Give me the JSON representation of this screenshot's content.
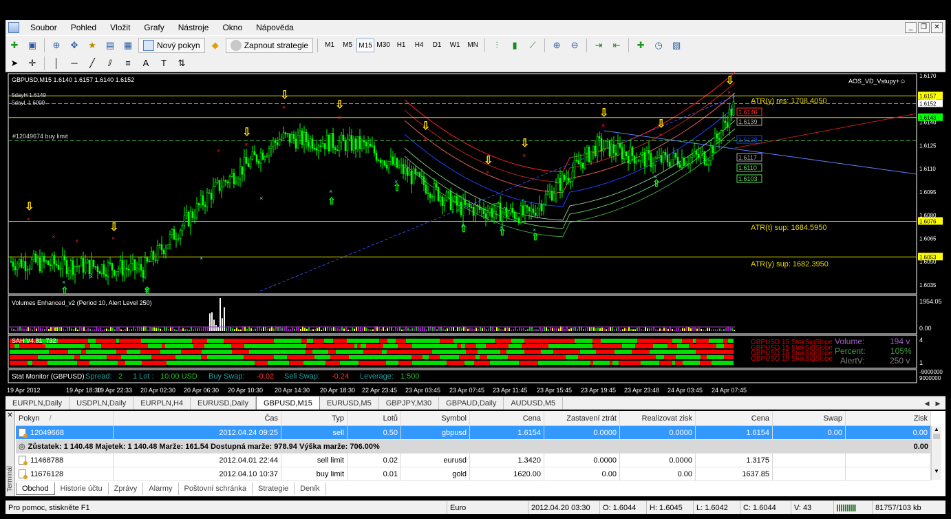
{
  "menu": [
    "Soubor",
    "Pohled",
    "Vložit",
    "Grafy",
    "Nástroje",
    "Okno",
    "Nápověda"
  ],
  "toolbar": {
    "new_order": "Nový pokyn",
    "strategy": "Zapnout strategie",
    "timeframes": [
      "M1",
      "M5",
      "M15",
      "M30",
      "H1",
      "H4",
      "D1",
      "W1",
      "MN"
    ],
    "active_timeframe": "M15"
  },
  "chart": {
    "symbol_line": "GBPUSD,M15  1.6140 1.6157 1.6140 1.6152",
    "indicator_name": "AOS_VD_Vstupy+☺",
    "overlay_top1": "5dayH 1.6149",
    "overlay_top2": "5dayL 1.6009",
    "buy_limit_label": "#12049674 buy limit",
    "atr_y_res": "ATR(y) res: 1708.4050",
    "atr_t_sup": "ATR(t) sup: 1684.5950",
    "atr_y_sup": "ATR(y) sup: 1682.3950",
    "price_labels": [
      "1.6170",
      "1.6155",
      "1.6140",
      "1.6125",
      "1.6110",
      "1.6095",
      "1.6080",
      "1.6065",
      "1.6050",
      "1.6035"
    ],
    "hl_prices": [
      "1.6157",
      "1.6152",
      "1.6143",
      "1.6076",
      "1.6053"
    ],
    "band_labels": [
      "1.6146",
      "1.6139",
      "1.6128",
      "1.6117",
      "1.6110",
      "1.6103"
    ],
    "volumes_title": "Volumes Enhanced_v2  (Period 10, Alert Level 250)",
    "volumes_max": "1954.05",
    "volumes_min": "0.00",
    "sah_title": "SAH V4.81_732",
    "sah_axis_top": "4",
    "sah_axis_bottom": "1",
    "sah_labels": [
      "GBPUSD 15 StokSigSlope",
      "GBPUSD 15 StokSigSlope",
      "GBPUSD 15 StokSigSlope",
      "GBPUSD 15 StokSigSlope"
    ],
    "sah_volume_label": "Volume:",
    "sah_volume_value": "194 v",
    "sah_percent_label": "Percent:",
    "sah_percent_value": "105%",
    "sah_alert_label": "AlertV:",
    "sah_alert_value": "250 v",
    "stat_monitor": {
      "name": "Stat Monitor (GBPUSD)",
      "spread_label": "Spread:",
      "spread": "2",
      "lot_label": "1 Lot :",
      "lot": "10.00 USD",
      "buyswap_label": "Buy Swap:",
      "buyswap": "-0.02",
      "sellswap_label": "Sell Swap:",
      "sellswap": "-0.24",
      "leverage_label": "Leverage:",
      "leverage": "1:500"
    },
    "stat_axis_top": "-9000000",
    "stat_axis_bottom": "9000000",
    "time_labels": [
      "19 Apr 2012",
      "19 Apr 18:30",
      "19 Apr 22:33",
      "20 Apr 02:30",
      "20 Apr 06:30",
      "20 Apr 10:30",
      "20 Apr 14:30",
      "20 Apr 18:30",
      "22 Apr 23:45",
      "23 Apr 03:45",
      "23 Apr 07:45",
      "23 Apr 11:45",
      "23 Apr 15:45",
      "23 Apr 19:45",
      "23 Apr 23:48",
      "24 Apr 03:45",
      "24 Apr 07:45"
    ],
    "colors": {
      "bull": "#00ff00",
      "bear": "#ff0000",
      "yellow_line": "#ffff00",
      "blue_band": "#1e3cff"
    }
  },
  "chart_tabs": [
    "EURPLN,Daily",
    "USDPLN,Daily",
    "EURPLN,H4",
    "EURUSD,Daily",
    "GBPUSD,M15",
    "EURUSD,M5",
    "GBPJPY,M30",
    "GBPAUD,Daily",
    "AUDUSD,M5"
  ],
  "active_chart_tab": "GBPUSD,M15",
  "terminal": {
    "side_label": "Terminál",
    "columns": [
      "Pokyn",
      "Čas",
      "Typ",
      "Lotů",
      "Symbol",
      "Cena",
      "Zastavení ztrát",
      "Realizovat zisk",
      "Cena",
      "Swap",
      "Zisk"
    ],
    "sort_mark": "/",
    "rows": [
      [
        "12049668",
        "2012.04.24 09:25",
        "sell",
        "0.50",
        "gbpusd",
        "1.6154",
        "0.0000",
        "0.0000",
        "1.6154",
        "0.00",
        "0.00"
      ],
      [
        "11468788",
        "2012.04.01 22:44",
        "sell limit",
        "0.02",
        "eurusd",
        "1.3420",
        "0.0000",
        "0.0000",
        "1.3175",
        "",
        ""
      ],
      [
        "11676128",
        "2012.04.10 10:37",
        "buy limit",
        "0.01",
        "gold",
        "1620.00",
        "0.00",
        "0.00",
        "1637.85",
        "",
        ""
      ]
    ],
    "summary": "Zůstatek: 1 140.48  Majetek: 1 140.48  Marže: 161.54  Dostupná marže: 978.94  Výška marže: 706.00%",
    "summary_profit": "0.00",
    "tabs": [
      "Obchod",
      "Historie účtu",
      "Zprávy",
      "Alarmy",
      "Poštovní schránka",
      "Strategie",
      "Deník"
    ],
    "active_tab": "Obchod"
  },
  "statusbar": {
    "help": "Pro pomoc, stiskněte F1",
    "profile": "Euro",
    "datetime": "2012.04.20 03:30",
    "open": "O: 1.6044",
    "high": "H: 1.6045",
    "low": "L: 1.6042",
    "close": "C: 1.6044",
    "volume": "V: 43",
    "traffic": "81757/103 kb"
  }
}
